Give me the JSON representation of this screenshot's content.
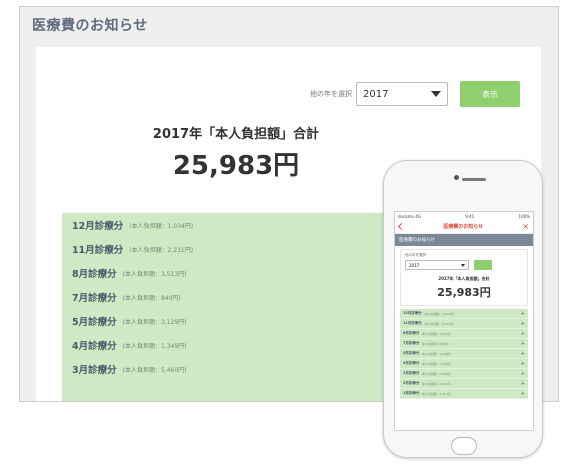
{
  "desktop": {
    "title": "医療費のお知らせ",
    "year_label": "他の年を選択",
    "year_value": "2017",
    "show_button": "表示",
    "summary_heading": "2017年「本人負担額」合計",
    "summary_amount": "25,983円",
    "rows": [
      {
        "month": "12月診療分",
        "detail": "(本人負担額：1,034円)"
      },
      {
        "month": "11月診療分",
        "detail": "(本人負担額：2,231円)"
      },
      {
        "month": "8月診療分",
        "detail": "(本人負担額：3,513円)"
      },
      {
        "month": "7月診療分",
        "detail": "(本人負担額：840円)"
      },
      {
        "month": "5月診療分",
        "detail": "(本人負担額：3,129円)"
      },
      {
        "month": "4月診療分",
        "detail": "(本人負担額：1,349円)"
      },
      {
        "month": "3月診療分",
        "detail": "(本人負担額：5,460円)"
      }
    ]
  },
  "phone": {
    "status_left": "docomo 4G",
    "status_center": "9:41",
    "status_right": "100%",
    "nav_title": "医療費のお知らせ",
    "subheader": "医療費のお知らせ",
    "year_label": "他の年を選択",
    "year_value": "2017",
    "summary_heading": "2017年「本人負担額」合計",
    "summary_amount": "25,983円",
    "rows": [
      {
        "month": "12月診療分",
        "detail": "(本人負担額：1,034円)"
      },
      {
        "month": "11月診療分",
        "detail": "(本人負担額：2,231円)"
      },
      {
        "month": "8月診療分",
        "detail": "(本人負担額：3,513円)"
      },
      {
        "month": "7月診療分",
        "detail": "(本人負担額：840円)"
      },
      {
        "month": "5月診療分",
        "detail": "(本人負担額：3,129円)"
      },
      {
        "month": "4月診療分",
        "detail": "(本人負担額：1,349円)"
      },
      {
        "month": "3月診療分",
        "detail": "(本人負担額：5,460円)"
      },
      {
        "month": "2月診療分",
        "detail": "(本人負担額：4,970円)"
      },
      {
        "month": "1月診療分",
        "detail": "(本人負担額：3,457円)"
      }
    ]
  }
}
